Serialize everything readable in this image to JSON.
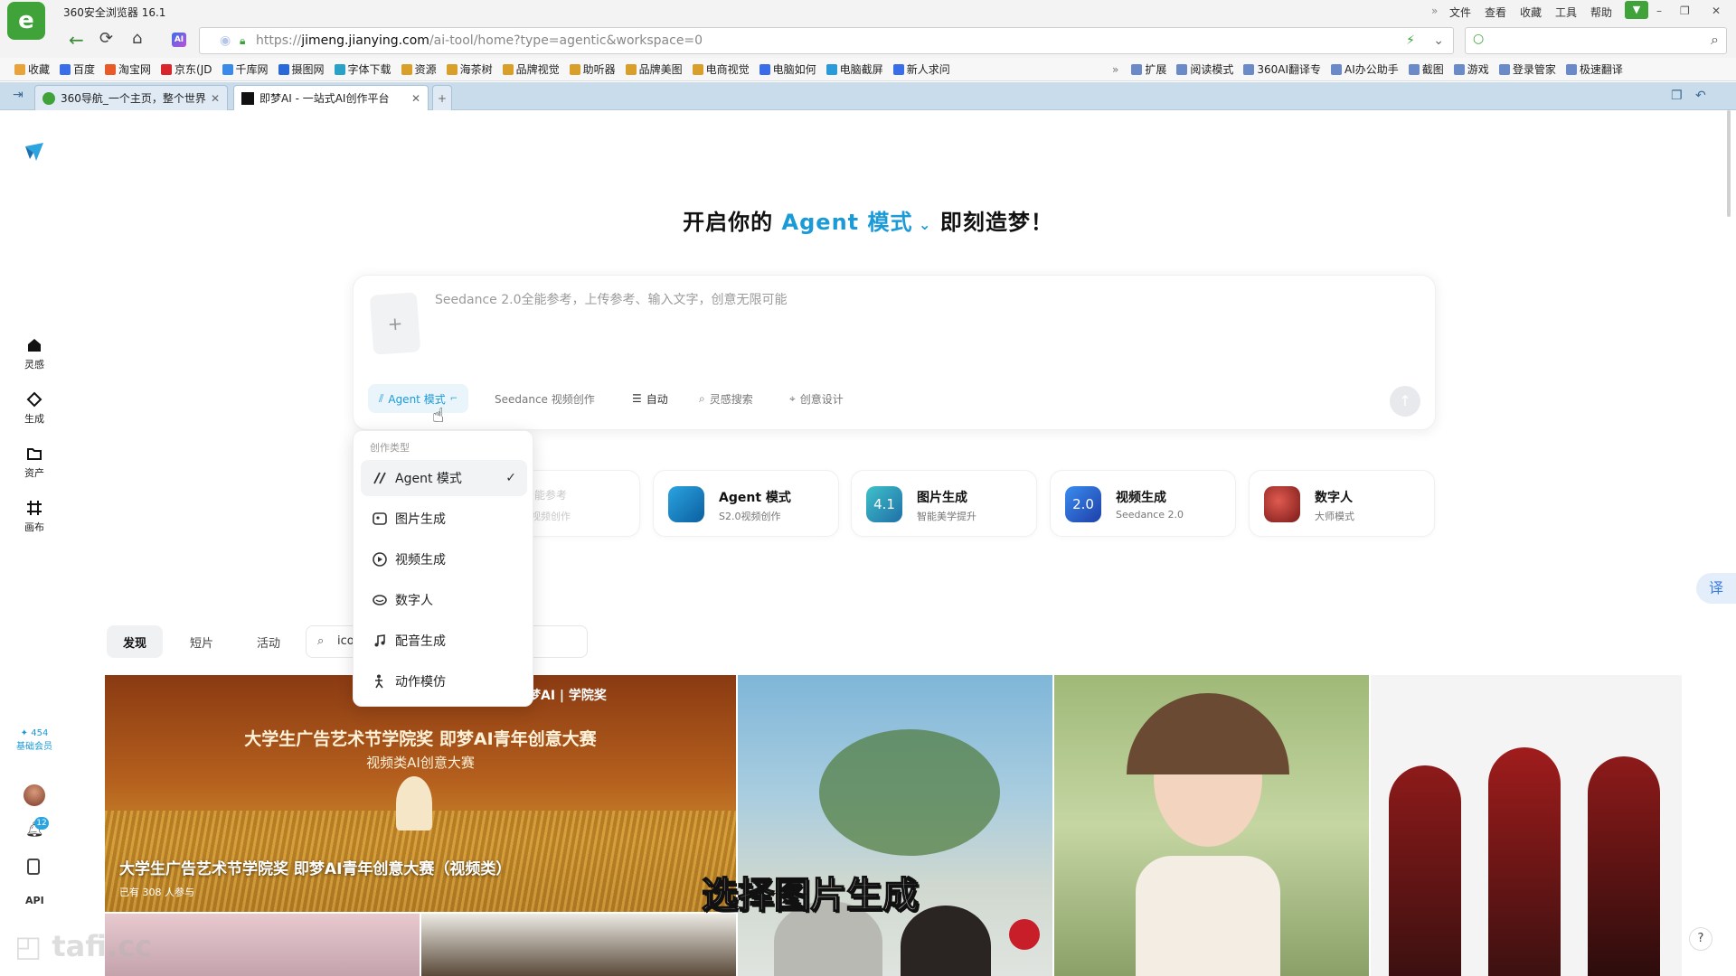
{
  "browser": {
    "title": "360安全浏览器 16.1",
    "menu": [
      "文件",
      "查看",
      "收藏",
      "工具",
      "帮助"
    ],
    "url_prefix": "https://",
    "url_host": "jimeng.jianying.com",
    "url_path": "/ai-tool/home?type=agentic&workspace=0",
    "bookmarks": [
      "收藏",
      "百度",
      "淘宝网",
      "京东(JD",
      "千库网",
      "摄图网",
      "字体下载",
      "资源",
      "海茶树",
      "品牌视觉",
      "助听器",
      "品牌美图",
      "电商视觉",
      "电脑如何",
      "电脑截屏",
      "新人求问"
    ],
    "bookmarks_right": [
      "扩展",
      "阅读模式",
      "360AI翻译专",
      "AI办公助手",
      "截图",
      "游戏",
      "登录管家",
      "极速翻译"
    ],
    "tabs": [
      {
        "label": "360导航_一个主页，整个世界"
      },
      {
        "label": "即梦AI - 一站式AI创作平台"
      }
    ],
    "new_tab": "+"
  },
  "sidebar": {
    "items": [
      {
        "label": "灵感",
        "icon": "home-icon"
      },
      {
        "label": "生成",
        "icon": "diamond-icon"
      },
      {
        "label": "资产",
        "icon": "folder-icon"
      },
      {
        "label": "画布",
        "icon": "canvas-icon"
      }
    ],
    "credits": "454",
    "membership": "基础会员",
    "notification_count": "12",
    "api_label": "API"
  },
  "headline": {
    "prefix": "开启你的",
    "mode": "Agent 模式",
    "suffix": "即刻造梦！"
  },
  "composer": {
    "placeholder": "Seedance 2.0全能参考，上传参考、输入文字，创意无限可能",
    "upload_plus": "+",
    "pills": {
      "agent": "Agent 模式",
      "seedance": "Seedance 视频创作",
      "auto": "自动",
      "search": "灵感搜索",
      "design": "创意设计"
    }
  },
  "dropdown": {
    "header": "创作类型",
    "items": [
      {
        "label": "Agent 模式",
        "icon": "agent-icon",
        "selected": true
      },
      {
        "label": "图片生成",
        "icon": "image-gen-icon"
      },
      {
        "label": "视频生成",
        "icon": "video-gen-icon"
      },
      {
        "label": "数字人",
        "icon": "digital-human-icon"
      },
      {
        "label": "配音生成",
        "icon": "music-note-icon"
      },
      {
        "label": "动作模仿",
        "icon": "motion-icon"
      }
    ]
  },
  "cards": [
    {
      "title": "",
      "sub": "全能参考",
      "sub2": "视频创作"
    },
    {
      "title": "Agent 模式",
      "sub": "S2.0视频创作",
      "color": "#2ba4e0"
    },
    {
      "title": "图片生成",
      "sub": "智能美学提升",
      "badge": "4.1",
      "color": "#1f8fb8"
    },
    {
      "title": "视频生成",
      "sub": "Seedance 2.0",
      "badge": "2.0",
      "color": "#1e6ed8"
    },
    {
      "title": "数字人",
      "sub": "大师模式",
      "color": "#b2302a"
    }
  ],
  "feed": {
    "tabs": [
      "发现",
      "短片",
      "活动"
    ],
    "search_value": "ico",
    "banner": {
      "brand": "即梦AI",
      "brand2": "学院奖",
      "line1": "大学生广告艺术节学院奖 即梦AI青年创意大赛",
      "line2": "视频类AI创意大赛",
      "caption_title": "大学生广告艺术节学院奖 即梦AI青年创意大赛（视频类）",
      "participants": "已有 308 人参与"
    }
  },
  "subtitle": "选择图片生成",
  "watermark": "tafi.cc",
  "translate_label": "译",
  "help_label": "?"
}
